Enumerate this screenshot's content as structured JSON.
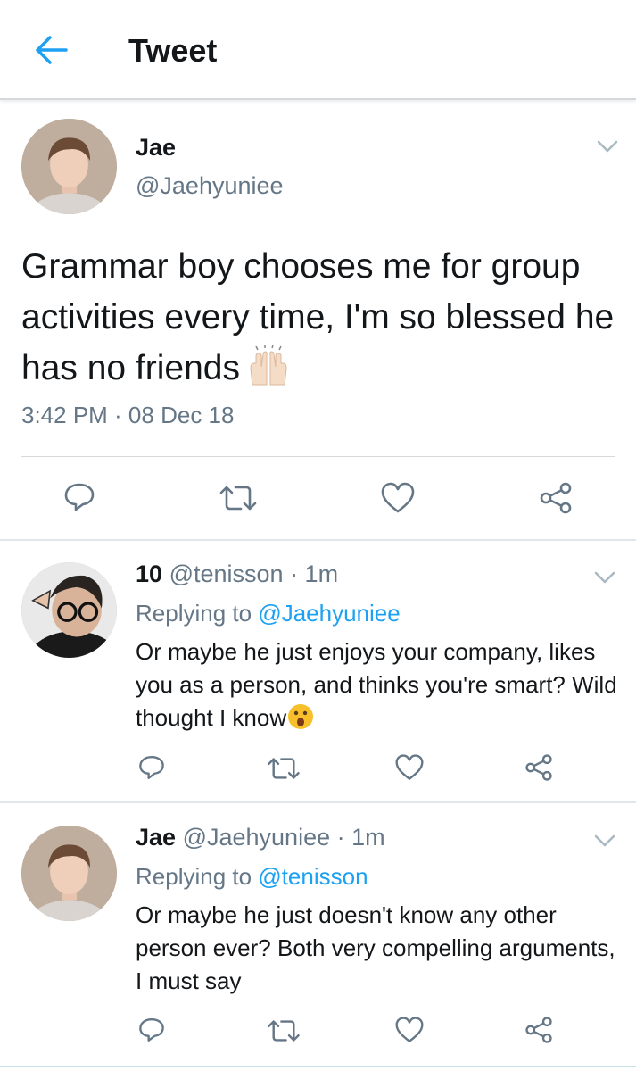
{
  "header": {
    "title": "Tweet"
  },
  "main_tweet": {
    "name": "Jae",
    "handle": "@Jaehyuniee",
    "text": "Grammar boy chooses me for group activities every time, I'm so blessed he has no friends",
    "time": "3:42 PM · 08 Dec 18"
  },
  "replies": [
    {
      "name": "10",
      "handle": "@tenisson",
      "time": "· 1m",
      "replying_prefix": "Replying to",
      "replying_to": "@Jaehyuniee",
      "text": "Or maybe he just enjoys your company, likes you as a person, and thinks you're smart? Wild thought I know"
    },
    {
      "name": "Jae",
      "handle": "@Jaehyuniee",
      "time": "· 1m",
      "replying_prefix": "Replying to",
      "replying_to": "@tenisson",
      "text": "Or maybe he just doesn't know any other person ever? Both very compelling arguments, I must say"
    }
  ],
  "icons": {
    "back": "arrow-left-icon",
    "menu": "chevron-down-icon",
    "reply": "reply-bubble-icon",
    "retweet": "retweet-icon",
    "like": "heart-icon",
    "share": "share-icon",
    "hands_emoji": "raising-hands-emoji",
    "wow_emoji": "hushed-face-emoji"
  },
  "colors": {
    "accent": "#1da1f2",
    "secondary_text": "#657786",
    "icon_gray": "#657786"
  }
}
